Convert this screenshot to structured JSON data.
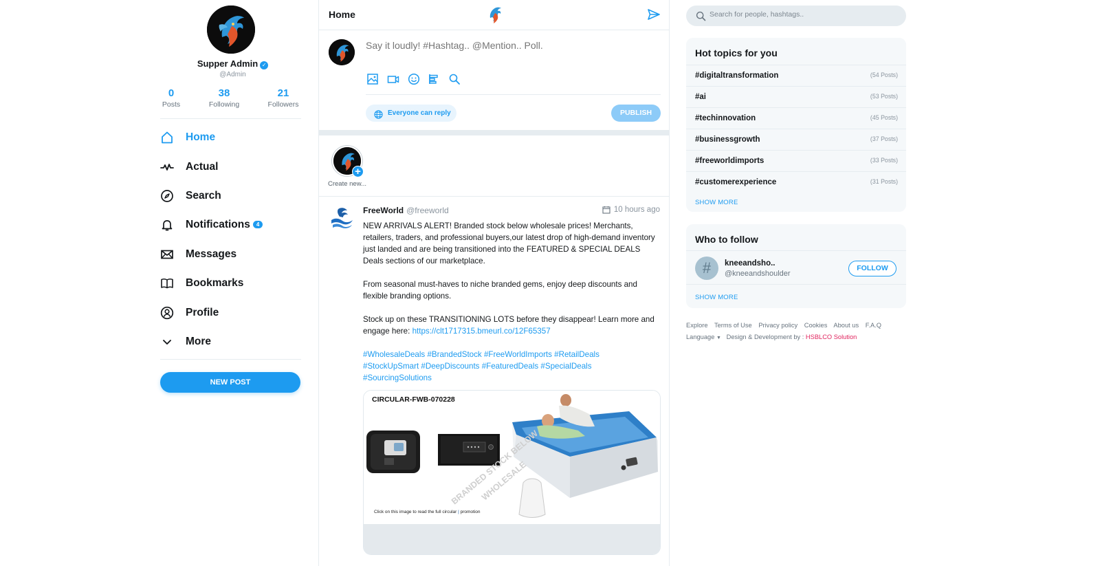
{
  "profile": {
    "name": "Supper Admin",
    "handle": "@Admin",
    "stats": [
      {
        "value": "0",
        "label": "Posts"
      },
      {
        "value": "38",
        "label": "Following"
      },
      {
        "value": "21",
        "label": "Followers"
      }
    ]
  },
  "nav": {
    "items": [
      {
        "label": "Home",
        "icon": "home-icon",
        "active": true
      },
      {
        "label": "Actual",
        "icon": "activity-icon"
      },
      {
        "label": "Search",
        "icon": "compass-icon"
      },
      {
        "label": "Notifications",
        "icon": "bell-icon",
        "badge": "4"
      },
      {
        "label": "Messages",
        "icon": "envelope-icon"
      },
      {
        "label": "Bookmarks",
        "icon": "book-icon"
      },
      {
        "label": "Profile",
        "icon": "user-circle-icon"
      },
      {
        "label": "More",
        "icon": "chevron-down-icon"
      }
    ],
    "new_post_label": "NEW POST"
  },
  "header": {
    "title": "Home"
  },
  "composer": {
    "placeholder": "Say it loudly! #Hashtag.. @Mention.. Poll.",
    "tools": [
      "image-icon",
      "video-icon",
      "emoji-icon",
      "poll-icon",
      "search-icon"
    ],
    "reply_label": "Everyone can reply",
    "publish_label": "PUBLISH"
  },
  "stories": {
    "create_label": "Create new..."
  },
  "post": {
    "author": "FreeWorld",
    "handle": "@freeworld",
    "time": "10 hours ago",
    "p1": "NEW ARRIVALS ALERT! Branded stock below wholesale prices! Merchants, retailers, traders, and professional buyers,our latest drop of high-demand inventory just landed and are being transitioned into the FEATURED & SPECIAL DEALS Deals sections of our marketplace.",
    "p2": "From seasonal must-haves to niche branded gems, enjoy deep discounts and flexible branding options.",
    "p3_text": "Stock up on these TRANSITIONING LOTS before they disappear! Learn more and engage here: ",
    "p3_link": "https://clt1717315.bmeurl.co/12F65357",
    "hashtags": "#WholesaleDeals #BrandedStock #FreeWorldImports #RetailDeals #StockUpSmart #DeepDiscounts #FeaturedDeals #SpecialDeals #SourcingSolutions",
    "card": {
      "code": "CIRCULAR-FWB-070228",
      "watermark_1": "BRANDED STOCK BELOW",
      "watermark_2": "WHOLESALE",
      "caption_pre": "Click on this image to read the full circular ",
      "caption_post": " promotion"
    }
  },
  "search": {
    "placeholder": "Search for people, hashtags.."
  },
  "hot_topics": {
    "title": "Hot topics for you",
    "items": [
      {
        "tag": "#digitaltransformation",
        "count": "(54 Posts)"
      },
      {
        "tag": "#ai",
        "count": "(53 Posts)"
      },
      {
        "tag": "#techinnovation",
        "count": "(45 Posts)"
      },
      {
        "tag": "#businessgrowth",
        "count": "(37 Posts)"
      },
      {
        "tag": "#freeworldimports",
        "count": "(33 Posts)"
      },
      {
        "tag": "#customerexperience",
        "count": "(31 Posts)"
      }
    ],
    "show_more": "SHOW MORE"
  },
  "who_to_follow": {
    "title": "Who to follow",
    "name": "kneeandsho..",
    "handle": "@kneeandshoulder",
    "follow_label": "FOLLOW",
    "show_more": "SHOW MORE"
  },
  "footer": {
    "links": [
      "Explore",
      "Terms of Use",
      "Privacy policy",
      "Cookies",
      "About us",
      "F.A.Q"
    ],
    "language": "Language",
    "credit": "Design & Development by :",
    "brand": "HSBLCO Solution"
  },
  "colors": {
    "accent": "#1d9bf0",
    "text": "#14171a",
    "muted": "#8a949e",
    "panel": "#f5f8fa",
    "brand_red": "#e0245e"
  }
}
